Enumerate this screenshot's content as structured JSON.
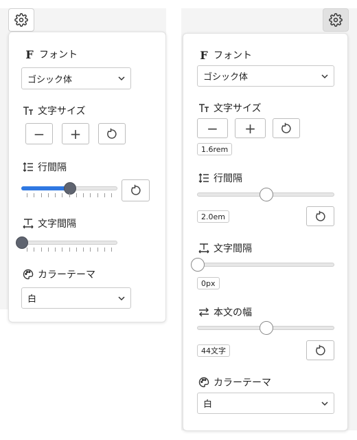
{
  "panel_left": {
    "font": {
      "label": "フォント",
      "icon": "font-f-icon",
      "selected": "ゴシック体"
    },
    "font_size": {
      "label": "文字サイズ",
      "icon": "text-size-icon",
      "decrease": "−",
      "increase": "+",
      "reset_icon": "reset-icon"
    },
    "line_height": {
      "label": "行間隔",
      "icon": "line-spacing-icon",
      "value_fraction": 0.5,
      "reset_icon": "reset-icon"
    },
    "letter_spacing": {
      "label": "文字間隔",
      "icon": "letter-spacing-icon",
      "value_fraction": 0.0
    },
    "color_theme": {
      "label": "カラーテーマ",
      "icon": "palette-icon",
      "selected": "白"
    }
  },
  "panel_right": {
    "font": {
      "label": "フォント",
      "icon": "font-f-icon",
      "selected": "ゴシック体"
    },
    "font_size": {
      "label": "文字サイズ",
      "icon": "text-size-icon",
      "decrease": "−",
      "increase": "+",
      "value": "1.6rem",
      "reset_icon": "reset-icon"
    },
    "line_height": {
      "label": "行間隔",
      "icon": "line-spacing-icon",
      "value": "2.0em",
      "value_fraction": 0.5,
      "reset_icon": "reset-icon"
    },
    "letter_spacing": {
      "label": "文字間隔",
      "icon": "letter-spacing-icon",
      "value": "0px",
      "value_fraction": 0.0
    },
    "text_width": {
      "label": "本文の幅",
      "icon": "width-arrows-icon",
      "value": "44文字",
      "value_fraction": 0.5,
      "reset_icon": "reset-icon"
    },
    "color_theme": {
      "label": "カラーテーマ",
      "icon": "palette-icon",
      "selected": "白"
    }
  },
  "colors": {
    "accent": "#2f78e2",
    "thumb_dark": "#5f6470",
    "panel_border": "#e2e2e2",
    "active_button_bg": "#e1e1e1"
  }
}
